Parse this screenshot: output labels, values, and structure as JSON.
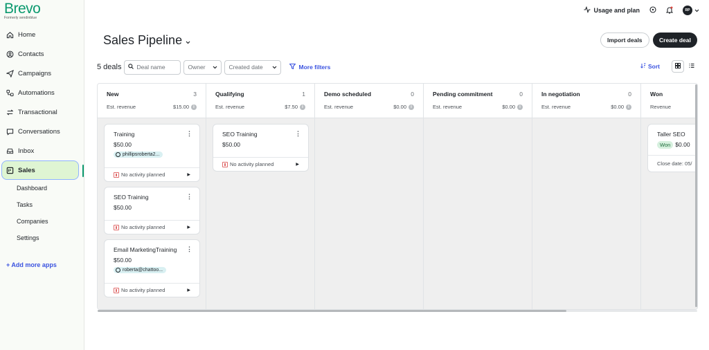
{
  "brand": {
    "name": "Brevo",
    "tagline": "Formerly sendinblue"
  },
  "sidebar": {
    "items": [
      {
        "label": "Home",
        "icon": "home-icon"
      },
      {
        "label": "Contacts",
        "icon": "contacts-icon"
      },
      {
        "label": "Campaigns",
        "icon": "send-icon"
      },
      {
        "label": "Automations",
        "icon": "automation-icon"
      },
      {
        "label": "Transactional",
        "icon": "transactional-icon"
      },
      {
        "label": "Conversations",
        "icon": "chat-icon"
      },
      {
        "label": "Inbox",
        "icon": "inbox-icon"
      },
      {
        "label": "Sales",
        "icon": "sales-icon"
      }
    ],
    "sub_items": [
      "Dashboard",
      "Tasks",
      "Companies",
      "Settings"
    ],
    "add_apps": "+ Add more apps"
  },
  "topbar": {
    "usage": "Usage and plan",
    "avatar": "RP"
  },
  "header": {
    "title": "Sales Pipeline",
    "import_label": "Import deals",
    "create_label": "Create deal"
  },
  "filters": {
    "deal_count": "5 deals",
    "search_placeholder": "Deal name",
    "owner": "Owner",
    "created_date": "Created date",
    "more_filters": "More filters",
    "sort": "Sort"
  },
  "columns": [
    {
      "title": "New",
      "count": "3",
      "revenue_label": "Est. revenue",
      "revenue": "$15.00"
    },
    {
      "title": "Qualifying",
      "count": "1",
      "revenue_label": "Est. revenue",
      "revenue": "$7.50"
    },
    {
      "title": "Demo scheduled",
      "count": "0",
      "revenue_label": "Est. revenue",
      "revenue": "$0.00"
    },
    {
      "title": "Pending commitment",
      "count": "0",
      "revenue_label": "Est. revenue",
      "revenue": "$0.00"
    },
    {
      "title": "In negotiation",
      "count": "0",
      "revenue_label": "Est. revenue",
      "revenue": "$0.00"
    },
    {
      "title": "Won",
      "count": "",
      "revenue_label": "Revenue",
      "revenue": ""
    }
  ],
  "cards": {
    "new": [
      {
        "name": "Training",
        "value": "$50.00",
        "contact": "phillipsroberta2...",
        "activity": "No activity planned"
      },
      {
        "name": "SEO Training",
        "value": "$50.00",
        "contact": "",
        "activity": "No activity planned"
      },
      {
        "name": "Email MarketingTraining",
        "value": "$50.00",
        "contact": "roberta@chattoo...",
        "activity": "No activity planned"
      }
    ],
    "qualifying": [
      {
        "name": "SEO Training",
        "value": "$50.00",
        "activity": "No activity planned"
      }
    ],
    "won": [
      {
        "name": "Taller SEO",
        "badge": "Won",
        "value": "$0.00",
        "close": "Close date: 05/"
      }
    ]
  },
  "colors": {
    "brand": "#0b996e",
    "accent": "#3b53e0",
    "dark": "#1f2328"
  }
}
